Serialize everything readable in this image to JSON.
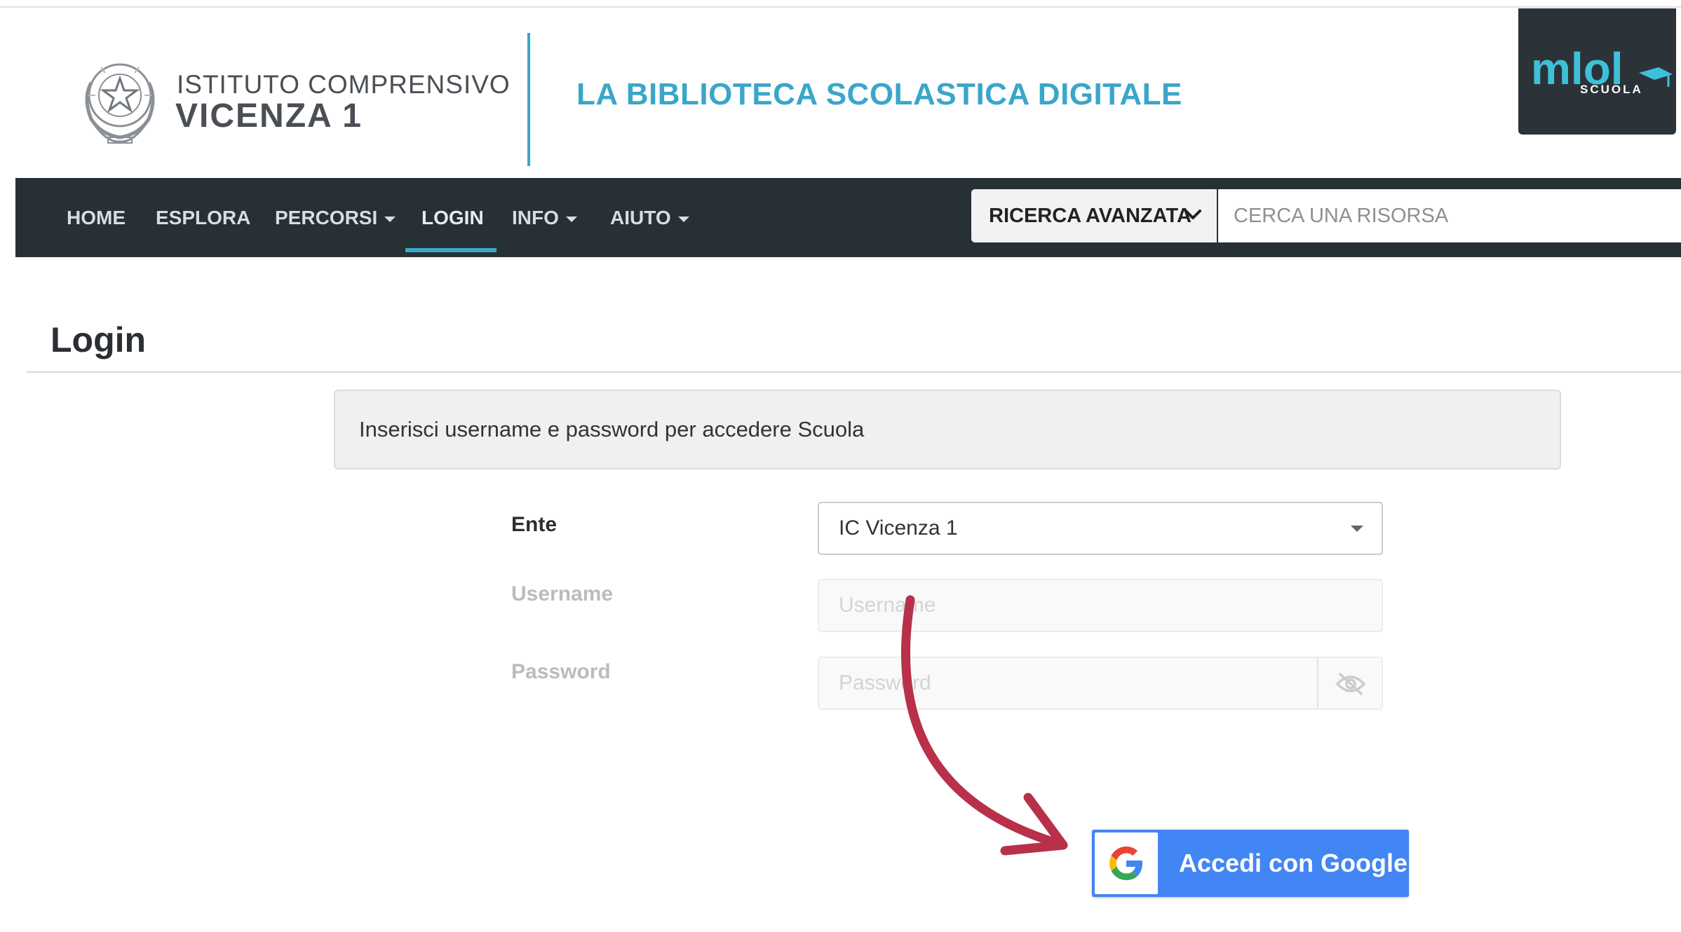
{
  "header": {
    "school_line1": "ISTITUTO COMPRENSIVO",
    "school_line2": "VICENZA 1",
    "library_title": "LA BIBLIOTECA SCOLASTICA DIGITALE",
    "brand_logo": {
      "text": "mlol",
      "subtext": "SCUOLA"
    }
  },
  "navbar": {
    "items": [
      {
        "label": "HOME",
        "dropdown": false,
        "active": false
      },
      {
        "label": "ESPLORA",
        "dropdown": false,
        "active": false
      },
      {
        "label": "PERCORSI",
        "dropdown": true,
        "active": false
      },
      {
        "label": "LOGIN",
        "dropdown": false,
        "active": true
      },
      {
        "label": "INFO",
        "dropdown": true,
        "active": false
      },
      {
        "label": "AIUTO",
        "dropdown": true,
        "active": false
      }
    ],
    "advanced_search_label": "RICERCA AVANZATA",
    "search_placeholder": "CERCA UNA RISORSA"
  },
  "page": {
    "title": "Login",
    "info_message": "Inserisci username e password per accedere Scuola"
  },
  "form": {
    "ente_label": "Ente",
    "ente_value": "IC Vicenza 1",
    "username_label": "Username",
    "username_placeholder": "Username",
    "password_label": "Password",
    "password_placeholder": "Password"
  },
  "google_button": {
    "label": "Accedi con Google"
  },
  "colors": {
    "navbar_bg": "#263035",
    "accent": "#3aa6c9",
    "google_blue": "#4285f4",
    "annotation_arrow": "#b8304a"
  }
}
